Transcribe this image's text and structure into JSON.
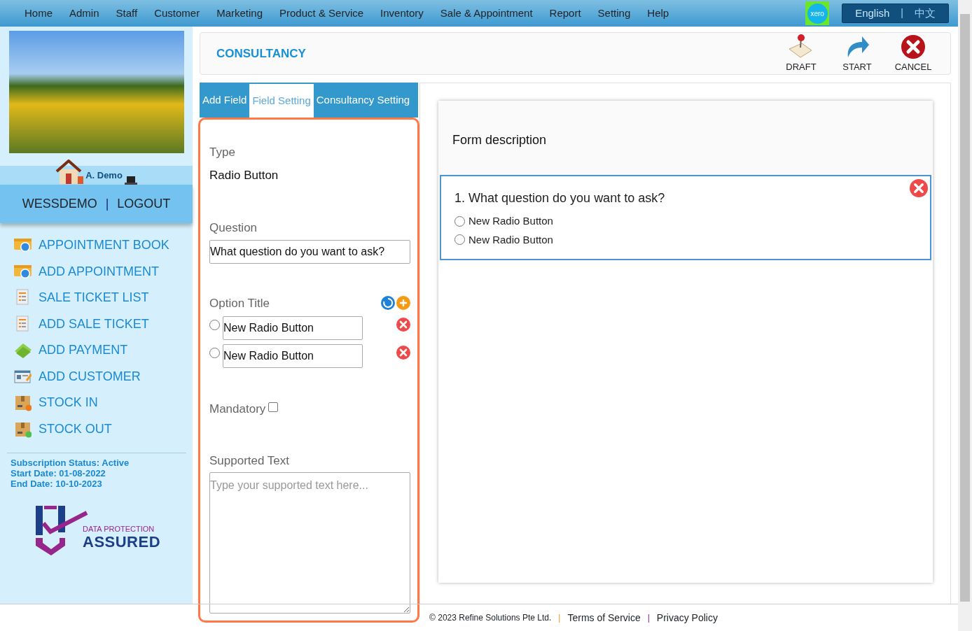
{
  "nav": {
    "items": [
      {
        "label": "Home"
      },
      {
        "label": "Admin"
      },
      {
        "label": "Staff"
      },
      {
        "label": "Customer"
      },
      {
        "label": "Marketing"
      },
      {
        "label": "Product & Service"
      },
      {
        "label": "Inventory"
      },
      {
        "label": "Sale & Appointment"
      },
      {
        "label": "Report"
      },
      {
        "label": "Setting"
      },
      {
        "label": "Help"
      }
    ],
    "xero_label": "xero",
    "languages": [
      {
        "label": "English",
        "selected": true
      },
      {
        "label": "中文",
        "selected": false
      }
    ],
    "language_separator": "|"
  },
  "sidebar": {
    "user_name": "A. Demo",
    "account_links": [
      {
        "label": "WESSDEMO"
      },
      {
        "label": "LOGOUT"
      }
    ],
    "account_separator": "|",
    "menu": [
      {
        "label": "APPOINTMENT BOOK",
        "kind": "calendar"
      },
      {
        "label": "ADD APPOINTMENT",
        "kind": "calendar"
      },
      {
        "label": "SALE TICKET LIST",
        "kind": "ticket"
      },
      {
        "label": "ADD SALE TICKET",
        "kind": "ticket"
      },
      {
        "label": "ADD PAYMENT",
        "kind": "money"
      },
      {
        "label": "ADD CUSTOMER",
        "kind": "card"
      },
      {
        "label": "STOCK IN",
        "kind": "box_in"
      },
      {
        "label": "STOCK OUT",
        "kind": "box_out"
      }
    ],
    "subscription": [
      "Subscription Status: Active",
      "Start Date: 01-08-2022",
      "End Date: 10-10-2023"
    ],
    "badge": {
      "line_1": "DATA PROTECTION",
      "line_2": "ASSURED"
    }
  },
  "header": {
    "title": "CONSULTANCY",
    "actions": [
      {
        "label": "DRAFT",
        "kind": "draft"
      },
      {
        "label": "START",
        "kind": "start"
      },
      {
        "label": "CANCEL",
        "kind": "cancel"
      }
    ]
  },
  "tabs": [
    {
      "label": "Add Field",
      "selected": false
    },
    {
      "label": "Field Setting",
      "selected": true
    },
    {
      "label": "Consultancy Setting",
      "selected": false
    }
  ],
  "field_setting": {
    "type_label": "Type",
    "type_value": "Radio Button",
    "question_label": "Question",
    "question_value": "What question do you want to ask?",
    "option_label": "Option Title",
    "options": [
      {
        "value": "New Radio Button",
        "selected": false
      },
      {
        "value": "New Radio Button",
        "selected": false
      }
    ],
    "mandatory_label": "Mandatory",
    "mandatory_checked": false,
    "supported_label": "Supported Text",
    "supported_placeholder": "Type your supported text here..."
  },
  "preview": {
    "description": "Form description",
    "question": "1. What question do you want to ask?",
    "options": [
      {
        "label": "New Radio Button",
        "selected": false
      },
      {
        "label": "New Radio Button",
        "selected": false
      }
    ]
  },
  "footer": {
    "copyright": "© 2023 Refine Solutions Pte Ltd.",
    "links": [
      {
        "label": "Terms of Service"
      },
      {
        "label": "Privacy Policy"
      }
    ],
    "separators": [
      "|",
      "|"
    ]
  }
}
